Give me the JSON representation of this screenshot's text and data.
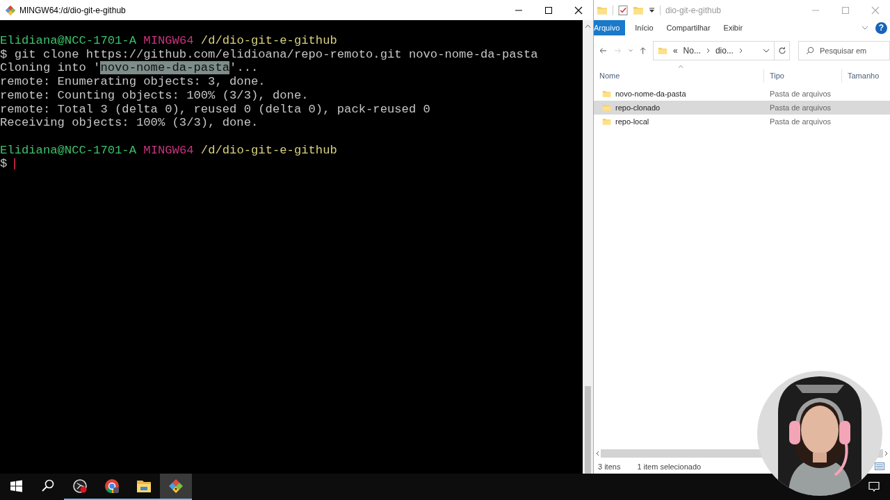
{
  "terminal": {
    "title": "MINGW64:/d/dio-git-e-github",
    "lines": [
      {
        "gap_before": false,
        "segments": [
          {
            "kind": "user",
            "text": "Elidiana@NCC-1701-A"
          },
          {
            "kind": "host",
            "text": "MINGW64"
          },
          {
            "kind": "path",
            "text": "/d/dio-git-e-github"
          }
        ]
      },
      {
        "gap_before": false,
        "segments": [
          {
            "kind": "plain",
            "text": "$ git clone https://github.com/elidioana/repo-remoto.git novo-nome-da-pasta"
          }
        ]
      },
      {
        "gap_before": false,
        "segments": [
          {
            "kind": "plain",
            "text": "Cloning into '"
          },
          {
            "kind": "selected",
            "text": "novo-nome-da-pasta"
          },
          {
            "kind": "plain",
            "text": "'..."
          }
        ]
      },
      {
        "gap_before": false,
        "segments": [
          {
            "kind": "plain",
            "text": "remote: Enumerating objects: 3, done."
          }
        ]
      },
      {
        "gap_before": false,
        "segments": [
          {
            "kind": "plain",
            "text": "remote: Counting objects: 100% (3/3), done."
          }
        ]
      },
      {
        "gap_before": false,
        "segments": [
          {
            "kind": "plain",
            "text": "remote: Total 3 (delta 0), reused 0 (delta 0), pack-reused 0"
          }
        ]
      },
      {
        "gap_before": false,
        "segments": [
          {
            "kind": "plain",
            "text": "Receiving objects: 100% (3/3), done."
          }
        ]
      },
      {
        "gap_before": true,
        "segments": [
          {
            "kind": "user",
            "text": "Elidiana@NCC-1701-A"
          },
          {
            "kind": "host",
            "text": "MINGW64"
          },
          {
            "kind": "path",
            "text": "/d/dio-git-e-github"
          }
        ]
      }
    ],
    "input_prompt": "$",
    "cursor": true
  },
  "explorer": {
    "title": "dio-git-e-github",
    "ribbon_tabs": [
      {
        "label": "Arquivo",
        "selected": true
      },
      {
        "label": "Início",
        "selected": false
      },
      {
        "label": "Compartilhar",
        "selected": false
      },
      {
        "label": "Exibir",
        "selected": false
      }
    ],
    "help": "?",
    "breadcrumb": [
      "«",
      "No...",
      "dio..."
    ],
    "search": {
      "placeholder": "Pesquisar em"
    },
    "columns": [
      "Nome",
      "Tipo",
      "Tamanho"
    ],
    "rows": [
      {
        "name": "novo-nome-da-pasta",
        "type": "Pasta de arquivos",
        "selected": false
      },
      {
        "name": "repo-clonado",
        "type": "Pasta de arquivos",
        "selected": true
      },
      {
        "name": "repo-local",
        "type": "Pasta de arquivos",
        "selected": false
      }
    ],
    "status": {
      "count": "3 itens",
      "selection": "1 item selecionado"
    }
  },
  "taskbar": {
    "items": [
      {
        "kind": "start",
        "running": false,
        "selected": false
      },
      {
        "kind": "search",
        "running": false,
        "selected": false
      },
      {
        "kind": "record",
        "running": true,
        "selected": false
      },
      {
        "kind": "browser",
        "running": true,
        "selected": false
      },
      {
        "kind": "folder",
        "running": true,
        "selected": false
      },
      {
        "kind": "git",
        "running": true,
        "selected": true
      }
    ]
  }
}
